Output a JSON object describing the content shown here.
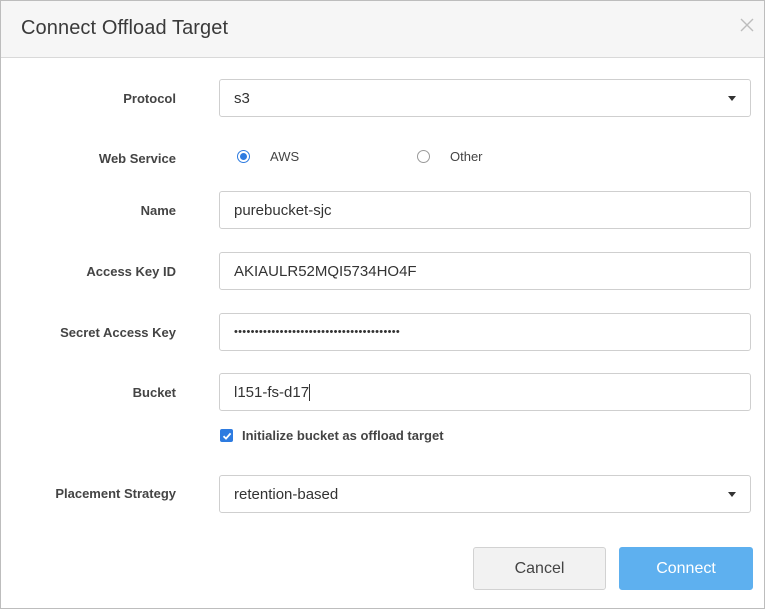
{
  "dialog": {
    "title": "Connect Offload Target",
    "close_icon": "close-icon"
  },
  "form": {
    "protocol": {
      "label": "Protocol",
      "value": "s3"
    },
    "web_service": {
      "label": "Web Service",
      "options": [
        {
          "label": "AWS",
          "selected": true
        },
        {
          "label": "Other",
          "selected": false
        }
      ]
    },
    "name": {
      "label": "Name",
      "value": "purebucket-sjc"
    },
    "access_key_id": {
      "label": "Access Key ID",
      "value": "AKIAULR52MQI5734HO4F"
    },
    "secret_access_key": {
      "label": "Secret Access Key",
      "value": "••••••••••••••••••••••••••••••••••••••••"
    },
    "bucket": {
      "label": "Bucket",
      "value": "l151-fs-d17"
    },
    "initialize": {
      "label": "Initialize bucket as offload target",
      "checked": true
    },
    "placement_strategy": {
      "label": "Placement Strategy",
      "value": "retention-based"
    }
  },
  "buttons": {
    "cancel": "Cancel",
    "connect": "Connect"
  },
  "colors": {
    "accent": "#2d7be0",
    "primary_button": "#5eb0ef",
    "header_bg": "#f6f6f6"
  }
}
